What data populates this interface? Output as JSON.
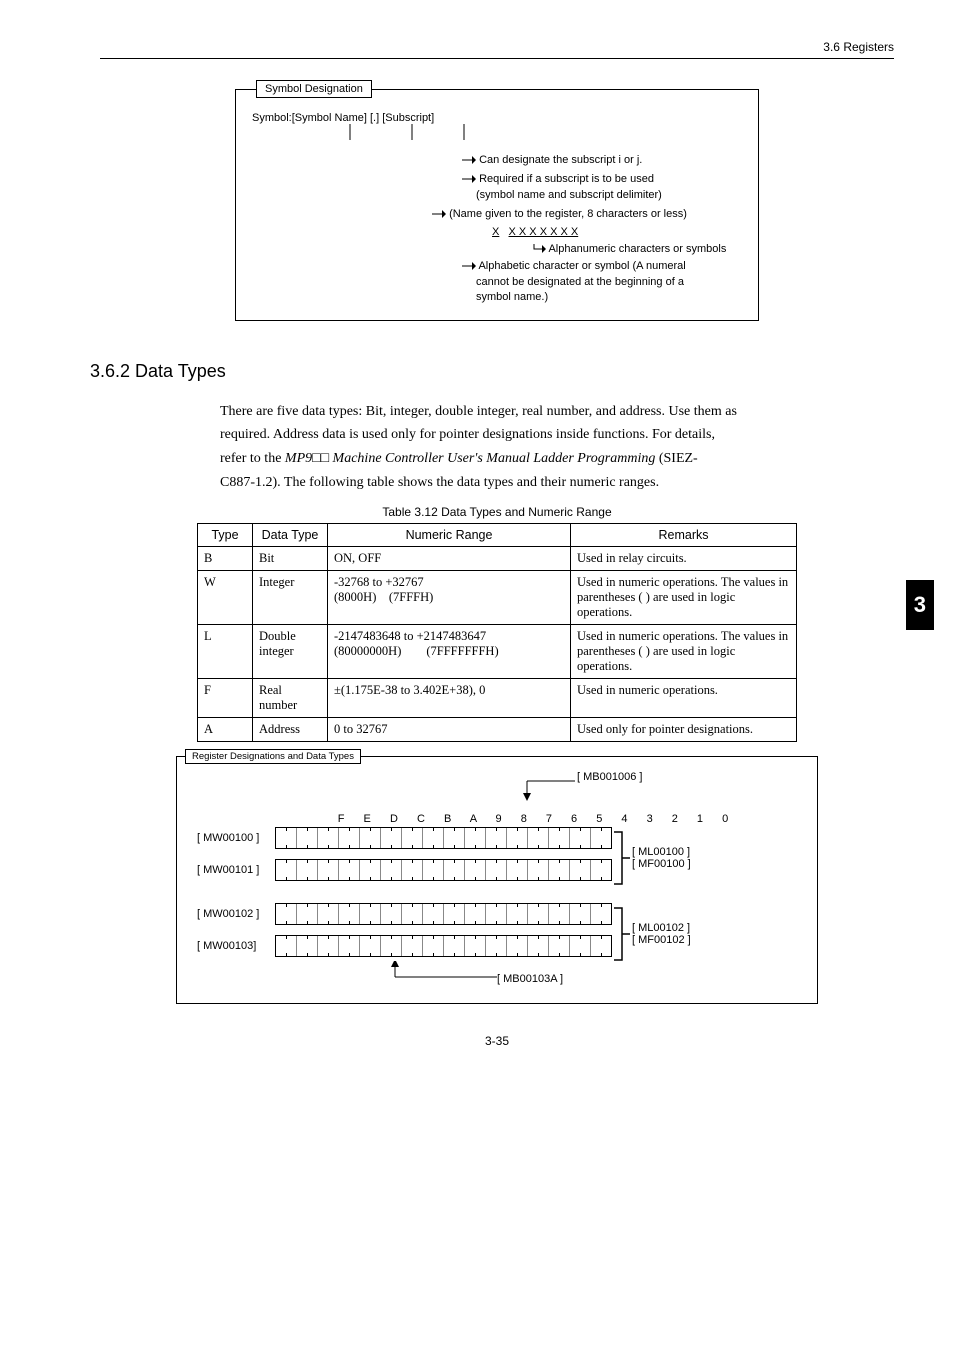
{
  "header": {
    "section_ref": "3.6  Registers"
  },
  "sidetab": "3",
  "diagram1": {
    "box_title": "Symbol Designation",
    "line": "Symbol:[Symbol Name]    [.]    [Subscript]",
    "arrow1": "Can designate the subscript i or j.",
    "arrow2a": "Required if a subscript is to be used",
    "arrow2b": "(symbol name and subscript delimiter)",
    "arrow3": "(Name given to the register, 8 characters or less)",
    "xline_a": "X",
    "xline_b": "X X X X X X X",
    "arrow4": "Alphanumeric characters or symbols",
    "arrow5a": "Alphabetic character or symbol (A numeral",
    "arrow5b": "cannot be designated at the beginning of a",
    "arrow5c": "symbol name.)"
  },
  "section_heading": "3.6.2  Data Types",
  "paragraph": {
    "l1": "There are five data types: Bit, integer, double integer, real number, and address. Use them as",
    "l2": "required. Address data is used only for pointer designations inside functions. For details,",
    "l3a": "refer to the ",
    "l3b_italic": "MP9□□ Machine Controller User's Manual Ladder Programming",
    "l3c": "  (SIEZ-",
    "l4": "C887-1.2). The following table shows the data types and their numeric ranges."
  },
  "table_caption": "Table 3.12  Data Types and Numeric Range",
  "table_headers": {
    "c1": "Type",
    "c2": "Data Type",
    "c3": "Numeric Range",
    "c4": "Remarks"
  },
  "table_rows": [
    {
      "c1": "B",
      "c2": "Bit",
      "c3": "ON, OFF",
      "c4": "Used in relay circuits."
    },
    {
      "c1": "W",
      "c2": "Integer",
      "c3": "-32768 to +32767\n(8000H) (7FFFH)",
      "c4": "Used in numeric operations. The values in parentheses ( ) are used in logic operations."
    },
    {
      "c1": "L",
      "c2": "Double integer",
      "c3": "-2147483648 to +2147483647\n(80000000H)  (7FFFFFFFH)",
      "c4": "Used in numeric operations. The values in parentheses ( ) are used in logic operations."
    },
    {
      "c1": "F",
      "c2": "Real number",
      "c3": "±(1.175E-38 to 3.402E+38), 0",
      "c4": "Used in numeric operations."
    },
    {
      "c1": "A",
      "c2": "Address",
      "c3": "0 to 32767",
      "c4": "Used only for pointer designations."
    }
  ],
  "diagram2": {
    "box_title": "Register Designations and Data Types",
    "top_label": "[ MB001006 ]",
    "bit_labels": "F   E   D   C   B   A   9   8   7   6   5   4   3   2   1   0",
    "rows": [
      {
        "left": "[ MW00100 ]",
        "right1": "[ ML00100 ]",
        "right2": "[ MF00100 ]"
      },
      {
        "left": "[ MW00101 ]"
      },
      {
        "left": "[ MW00102 ]",
        "right1": "[ ML00102 ]",
        "right2": "[ MF00102 ]"
      },
      {
        "left": "[ MW00103]"
      }
    ],
    "bottom_label": "[ MB00103A ]"
  },
  "footer": "3-35"
}
